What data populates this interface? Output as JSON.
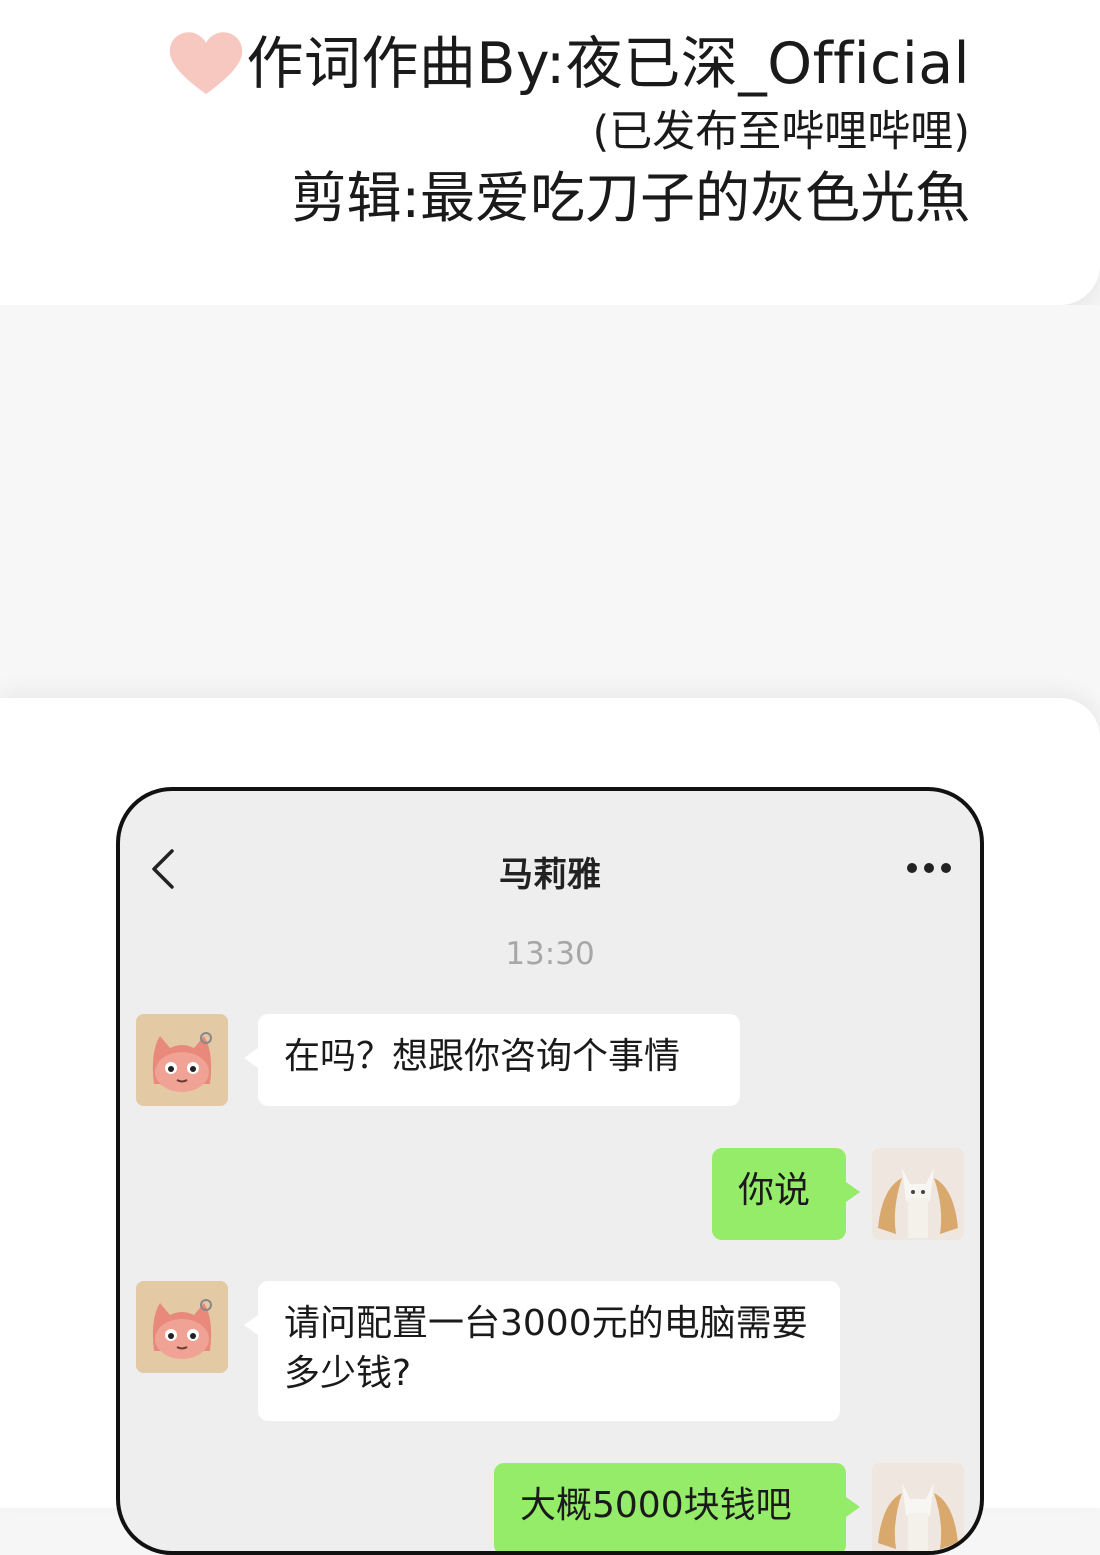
{
  "credits": {
    "line1": "作词作曲By:夜已深_Official",
    "line2": "(已发布至哔哩哔哩)",
    "line3": "剪辑:最爱吃刀子的灰色光魚"
  },
  "chat": {
    "title": "马莉雅",
    "timestamp": "13:30",
    "messages": [
      {
        "side": "in",
        "text": "在吗？想跟你咨询个事情"
      },
      {
        "side": "out",
        "text": "你说"
      },
      {
        "side": "in",
        "text": "请问配置一台3000元的电脑需要多少钱?"
      },
      {
        "side": "out",
        "text": "大概5000块钱吧"
      }
    ]
  },
  "colors": {
    "out_bubble": "#95ec69",
    "in_bubble": "#ffffff",
    "chat_background": "#eeeeee",
    "heart": "#f7c8c0"
  },
  "icons": {
    "heart": "heart-icon",
    "back": "chevron-left-icon",
    "more": "more-dots-icon",
    "contact_avatar": "cat-avatar",
    "self_avatar": "fox-avatar"
  }
}
